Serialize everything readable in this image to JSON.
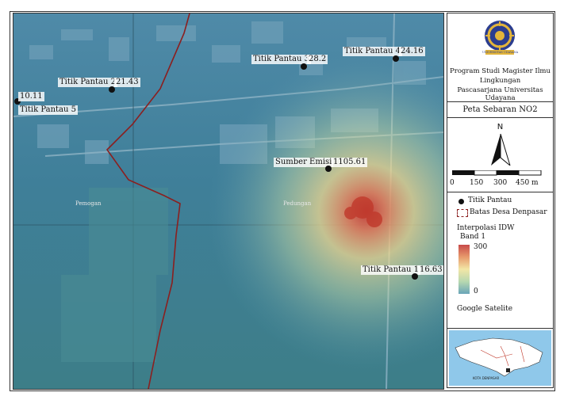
{
  "institution": {
    "logo_icon": "universitas-udayana-seal-icon",
    "logo_text": "UNIVERSITAS UDAYANA",
    "line1": "Program Studi Magister Ilmu",
    "line2": "Lingkungan",
    "line3": "Pascasarjana Universitas Udayana"
  },
  "map_title": "Peta Sebaran NO2",
  "north": {
    "label": "N",
    "icon": "north-arrow-icon"
  },
  "scale_bar": {
    "ticks": [
      "0",
      "150",
      "300",
      "450 m"
    ]
  },
  "legend": {
    "point_label": "Titik Pantau",
    "boundary_label": "Batas Desa Denpasar",
    "interp_title": "Interpolasi IDW",
    "band_label": "Band 1",
    "max_label": "300",
    "min_label": "0",
    "basemap_label": "Google Satelite",
    "ramp_colors": [
      "#c84a4a",
      "#e79a6c",
      "#f2e6a6",
      "#b7d8b0",
      "#6aa5b8"
    ]
  },
  "points": [
    {
      "name": "Titik Pantau 1",
      "value": "16.63"
    },
    {
      "name": "Titik Pantau 2",
      "value": "21.43"
    },
    {
      "name": "Titik Pantau 3",
      "value": "28.2"
    },
    {
      "name": "Titik Pantau 4",
      "value": "24.16"
    },
    {
      "name": "Titik Pantau 5",
      "value": "10.11"
    },
    {
      "name": "Sumber Emisi",
      "value": "1105.61"
    }
  ],
  "places": [
    "Pemogan",
    "Pedungan"
  ],
  "inset": {
    "label": "KOTA DENPASAR",
    "icon": "bali-island-inset-map"
  }
}
